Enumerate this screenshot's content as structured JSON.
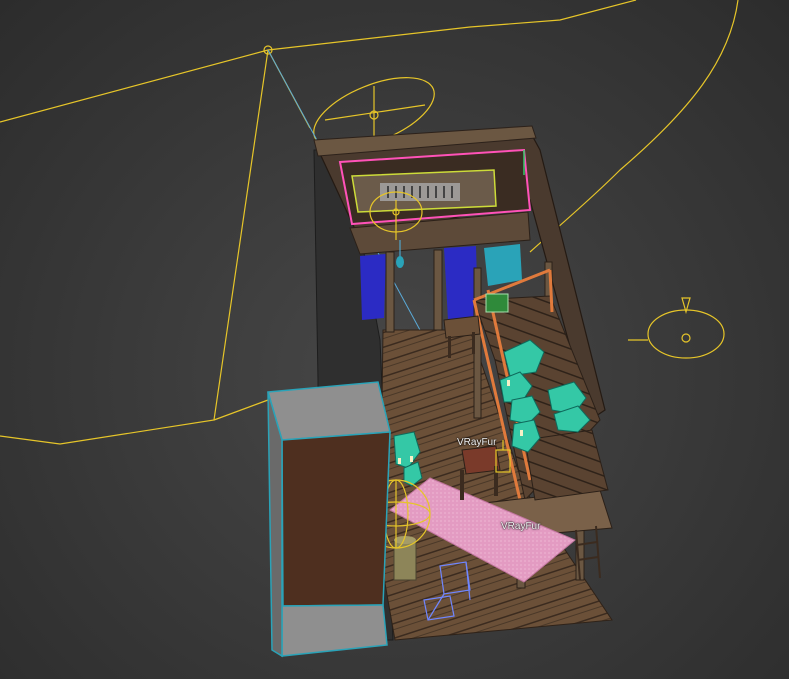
{
  "viewport": {
    "object_labels": [
      "VRayFur",
      "VRayFur"
    ]
  },
  "colors": {
    "background": "#3a3a3a",
    "helper_wireframe": "#e6c529",
    "selection_wireframe": "#5aa9d6",
    "lamp_wireframe": "#d9d247",
    "wood_dark": "#4b3a2c",
    "wood_light": "#8a6d50",
    "grass_accent": "#34c8a6",
    "rug_pink": "#e49bc3",
    "tarp_blue": "#2b2bc4",
    "tarp_teal": "#2aa3b8",
    "neon_pink": "#ff52b8",
    "box_gray": "#8f8f8f",
    "box_face_brown": "#4e2f1f"
  },
  "icons": {
    "camera": "camera-icon",
    "omni_light": "omni-light-icon",
    "sun": "sun-light-icon"
  }
}
